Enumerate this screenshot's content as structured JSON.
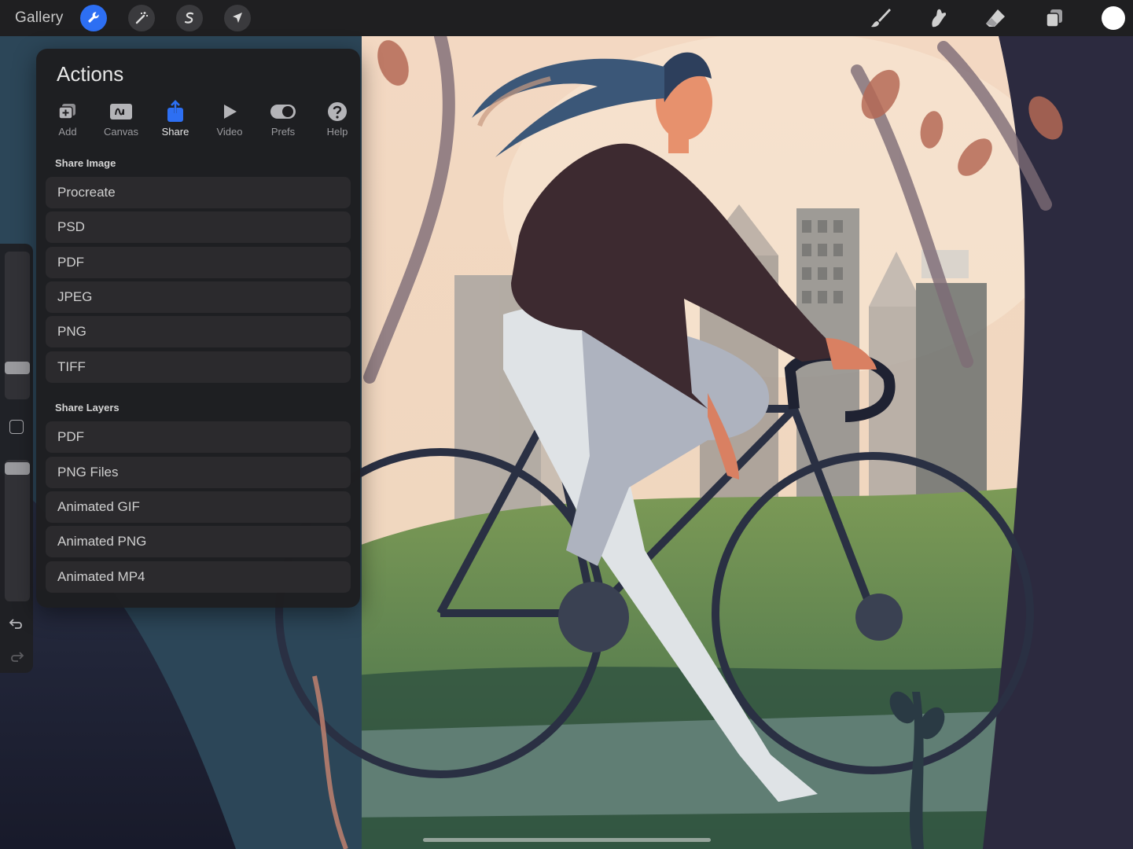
{
  "topbar": {
    "gallery_label": "Gallery",
    "left_tools": [
      {
        "name": "actions-wrench",
        "icon": "wrench-icon",
        "active": true
      },
      {
        "name": "adjustments",
        "icon": "magic-wand-icon",
        "active": false
      },
      {
        "name": "selection",
        "icon": "selection-s-icon",
        "active": false
      },
      {
        "name": "transform",
        "icon": "arrow-cursor-icon",
        "active": false
      }
    ],
    "right_tools": [
      "brush-icon",
      "smudge-icon",
      "eraser-icon",
      "layers-icon"
    ],
    "current_color": "#ffffff",
    "accent": "#2d6ff3"
  },
  "actions": {
    "title": "Actions",
    "tabs": [
      {
        "label": "Add",
        "icon": "add-image-icon"
      },
      {
        "label": "Canvas",
        "icon": "canvas-icon"
      },
      {
        "label": "Share",
        "icon": "share-icon",
        "selected": true
      },
      {
        "label": "Video",
        "icon": "play-icon"
      },
      {
        "label": "Prefs",
        "icon": "toggle-icon"
      },
      {
        "label": "Help",
        "icon": "help-icon"
      }
    ],
    "share_image": {
      "heading": "Share Image",
      "items": [
        "Procreate",
        "PSD",
        "PDF",
        "JPEG",
        "PNG",
        "TIFF"
      ]
    },
    "share_layers": {
      "heading": "Share Layers",
      "items": [
        "PDF",
        "PNG Files",
        "Animated GIF",
        "Animated PNG",
        "Animated MP4"
      ]
    }
  },
  "sidebar": {
    "brush_size": 0.18,
    "brush_opacity": 1.0,
    "icons": [
      "modify-square-icon",
      "undo-icon",
      "redo-icon"
    ]
  }
}
